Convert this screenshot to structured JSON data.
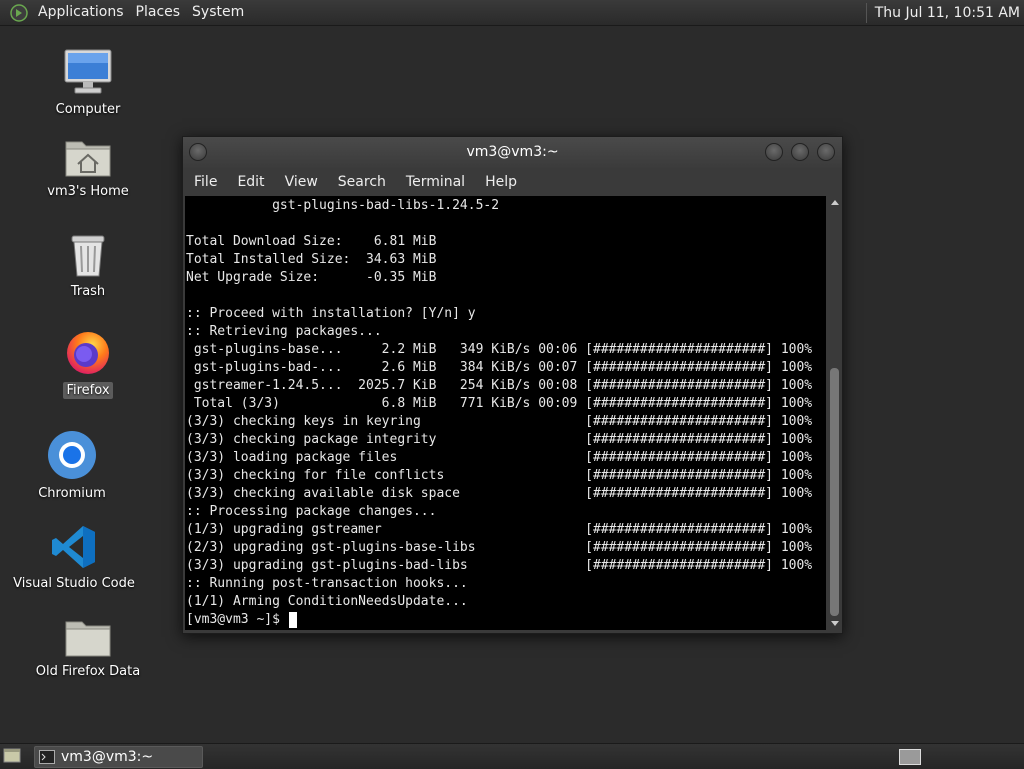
{
  "top_panel": {
    "menus": [
      "Applications",
      "Places",
      "System"
    ],
    "clock": "Thu Jul 11, 10:51 AM"
  },
  "desktop_icons": [
    {
      "label": "Computer",
      "icon": "computer-icon"
    },
    {
      "label": "vm3's Home",
      "icon": "home-folder-icon"
    },
    {
      "label": "Trash",
      "icon": "trash-icon"
    },
    {
      "label": "Firefox",
      "icon": "firefox-icon",
      "selected": true
    },
    {
      "label": "Chromium",
      "icon": "chromium-icon"
    },
    {
      "label": "Visual Studio Code",
      "icon": "vscode-icon"
    },
    {
      "label": "Old Firefox Data",
      "icon": "folder-icon"
    }
  ],
  "terminal": {
    "title": "vm3@vm3:~",
    "menu": [
      "File",
      "Edit",
      "View",
      "Search",
      "Terminal",
      "Help"
    ],
    "lines": [
      "           gst-plugins-bad-libs-1.24.5-2",
      "",
      "Total Download Size:    6.81 MiB",
      "Total Installed Size:  34.63 MiB",
      "Net Upgrade Size:      -0.35 MiB",
      "",
      ":: Proceed with installation? [Y/n] y",
      ":: Retrieving packages...",
      " gst-plugins-base...     2.2 MiB   349 KiB/s 00:06 [######################] 100%",
      " gst-plugins-bad-...     2.6 MiB   384 KiB/s 00:07 [######################] 100%",
      " gstreamer-1.24.5...  2025.7 KiB   254 KiB/s 00:08 [######################] 100%",
      " Total (3/3)             6.8 MiB   771 KiB/s 00:09 [######################] 100%",
      "(3/3) checking keys in keyring                     [######################] 100%",
      "(3/3) checking package integrity                   [######################] 100%",
      "(3/3) loading package files                        [######################] 100%",
      "(3/3) checking for file conflicts                  [######################] 100%",
      "(3/3) checking available disk space                [######################] 100%",
      ":: Processing package changes...",
      "(1/3) upgrading gstreamer                          [######################] 100%",
      "(2/3) upgrading gst-plugins-base-libs              [######################] 100%",
      "(3/3) upgrading gst-plugins-bad-libs               [######################] 100%",
      ":: Running post-transaction hooks...",
      "(1/1) Arming ConditionNeedsUpdate..."
    ],
    "prompt": "[vm3@vm3 ~]$ "
  },
  "taskbar": {
    "window_button": "vm3@vm3:~"
  },
  "colors": {
    "desktop_bg": "#2b2b2b",
    "terminal_bg": "#000000",
    "panel_bg": "#2f2f2f"
  }
}
